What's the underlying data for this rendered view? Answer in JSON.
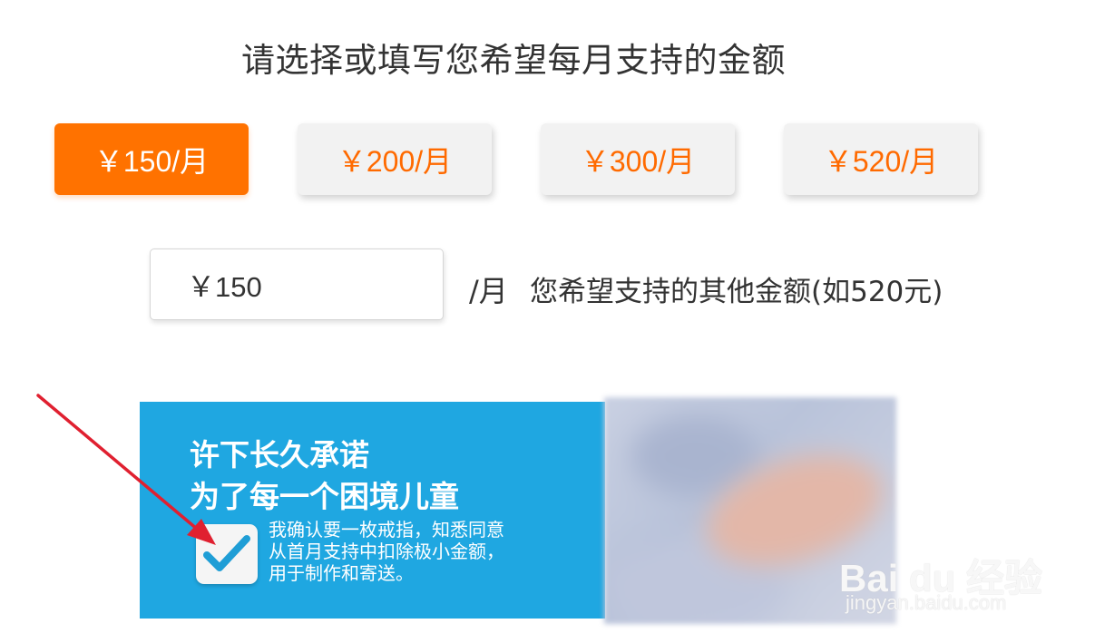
{
  "header": {
    "title": "请选择或填写您希望每月支持的金额"
  },
  "amounts": [
    {
      "label": "￥150/月",
      "selected": true
    },
    {
      "label": "￥200/月",
      "selected": false
    },
    {
      "label": "￥300/月",
      "selected": false
    },
    {
      "label": "￥520/月",
      "selected": false
    }
  ],
  "custom_amount": {
    "value": "￥150",
    "unit": "/月",
    "hint": "您希望支持的其他金额(如520元)"
  },
  "promo": {
    "heading_line1": "许下长久承诺",
    "heading_line2": "为了每一个困境儿童",
    "consent_checked": true,
    "consent_lines": [
      "我确认要一枚戒指，知悉同意",
      "从首月支持中扣除极小金额，",
      "用于制作和寄送。"
    ]
  },
  "watermark": {
    "logo_text": "Bai du 经验",
    "site": "jingyan.baidu.com"
  },
  "colors": {
    "accent_orange": "#ff7200",
    "promo_blue": "#1fa7e1",
    "checkmark_blue": "#1f9ed6",
    "annotation_red": "#e02030"
  }
}
